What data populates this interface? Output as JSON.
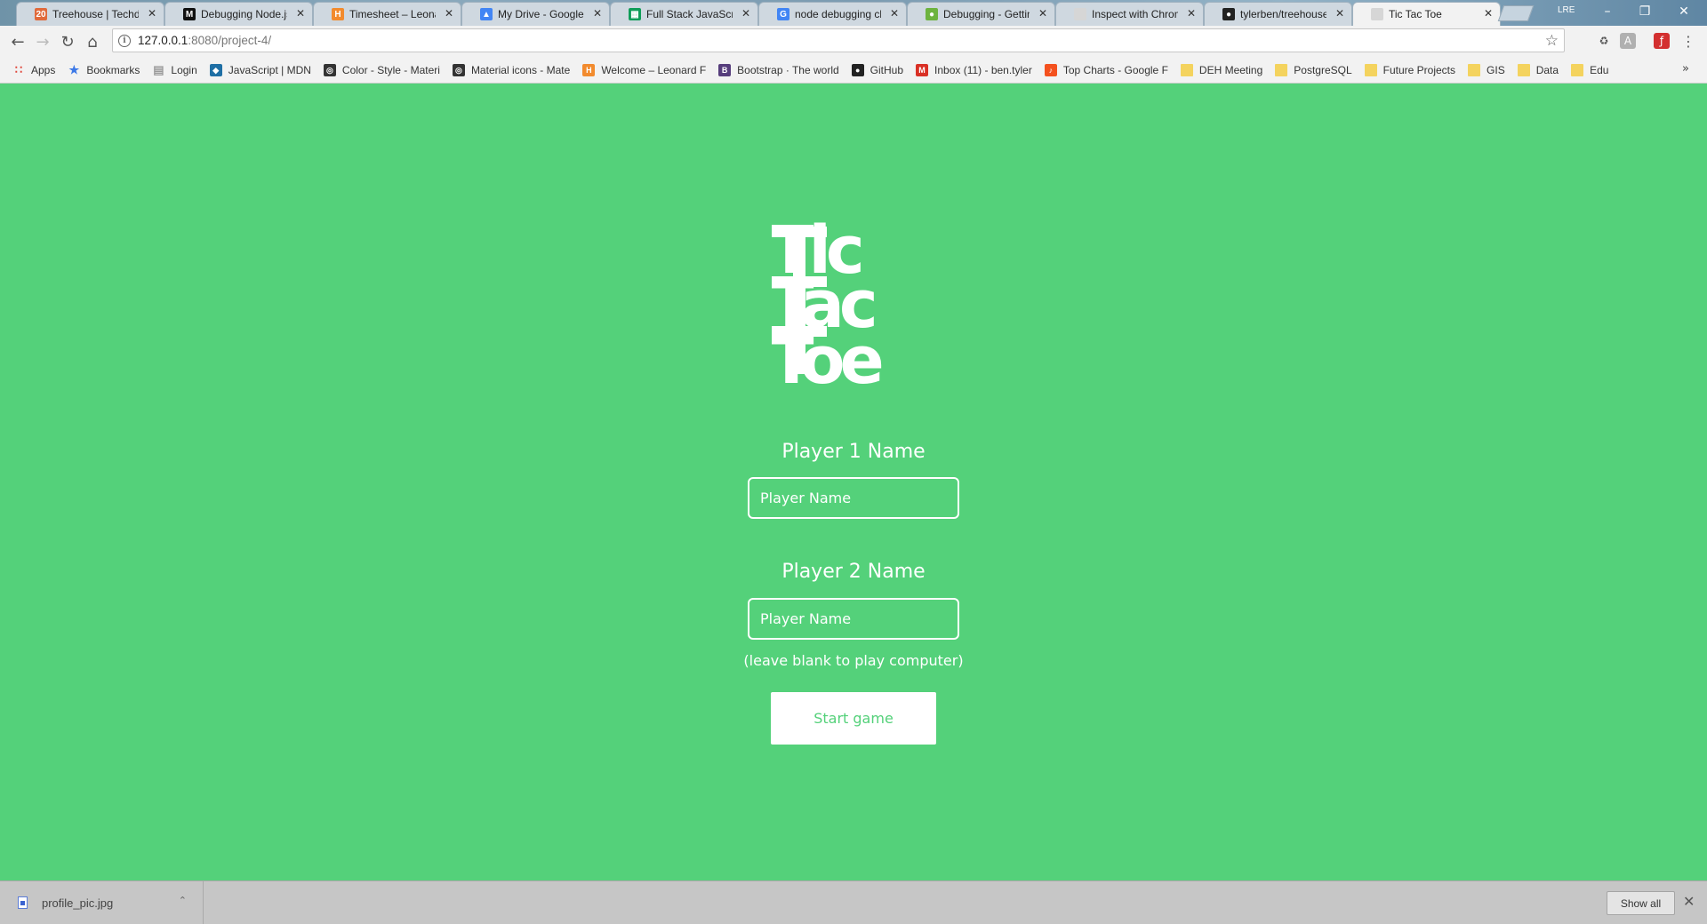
{
  "browser": {
    "tabs": [
      {
        "title": "Treehouse | Techdeg",
        "favicon_text": "20",
        "favicon_color": "#e06a3b"
      },
      {
        "title": "Debugging Node.js",
        "favicon_text": "M",
        "favicon_color": "#111111"
      },
      {
        "title": "Timesheet – Leonar",
        "favicon_text": "H",
        "favicon_color": "#f28b2e"
      },
      {
        "title": "My Drive - Google D",
        "favicon_text": "▲",
        "favicon_color": "#4285f4"
      },
      {
        "title": "Full Stack JavaScript",
        "favicon_text": "▦",
        "favicon_color": "#0f9d58"
      },
      {
        "title": "node debugging ch",
        "favicon_text": "G",
        "favicon_color": "#4285f4"
      },
      {
        "title": "Debugging - Gettin",
        "favicon_text": "●",
        "favicon_color": "#6db33f"
      },
      {
        "title": "Inspect with Chrom",
        "favicon_text": "",
        "favicon_color": "#d6d6d6"
      },
      {
        "title": "tylerben/treehouse",
        "favicon_text": "●",
        "favicon_color": "#222222"
      },
      {
        "title": "Tic Tac Toe",
        "favicon_text": "",
        "favicon_color": "#d6d6d6"
      }
    ],
    "profile_label": "LRE",
    "address": {
      "host": "127.0.0.1",
      "path": ":8080/project-4/"
    },
    "bookmarks": [
      {
        "label": "Apps",
        "icon": "apps-grid-icon",
        "color": "#e0463a"
      },
      {
        "label": "Bookmarks",
        "icon": "star-icon",
        "color": "#3b78e7"
      },
      {
        "label": "Login",
        "icon": "page-icon",
        "color": "#9a9a9a"
      },
      {
        "label": "JavaScript | MDN",
        "icon": "mdn-icon",
        "color": "#1f6fa5"
      },
      {
        "label": "Color - Style - Materi",
        "icon": "material-icon",
        "color": "#333333"
      },
      {
        "label": "Material icons - Mate",
        "icon": "material-icon",
        "color": "#333333"
      },
      {
        "label": "Welcome – Leonard F",
        "icon": "harvest-icon",
        "color": "#f28b2e"
      },
      {
        "label": "Bootstrap · The world",
        "icon": "bootstrap-icon",
        "color": "#563d7c"
      },
      {
        "label": "GitHub",
        "icon": "github-icon",
        "color": "#222222"
      },
      {
        "label": "Inbox (11) - ben.tyler",
        "icon": "gmail-icon",
        "color": "#d93025"
      },
      {
        "label": "Top Charts - Google F",
        "icon": "charts-icon",
        "color": "#f4511e"
      },
      {
        "label": "DEH Meeting",
        "icon": "folder-icon",
        "color": "#f4d35e"
      },
      {
        "label": "PostgreSQL",
        "icon": "folder-icon",
        "color": "#f4d35e"
      },
      {
        "label": "Future Projects",
        "icon": "folder-icon",
        "color": "#f4d35e"
      },
      {
        "label": "GIS",
        "icon": "folder-icon",
        "color": "#f4d35e"
      },
      {
        "label": "Data",
        "icon": "folder-icon",
        "color": "#f4d35e"
      },
      {
        "label": "Edu",
        "icon": "folder-icon",
        "color": "#f4d35e"
      }
    ]
  },
  "page": {
    "background": "#54d17a",
    "logo": [
      "Tic",
      "Tac",
      "Toe"
    ],
    "player1_label": "Player 1 Name",
    "player1_placeholder": "Player Name",
    "player2_label": "Player 2 Name",
    "player2_placeholder": "Player Name",
    "hint": "(leave blank to play computer)",
    "start_button": "Start game"
  },
  "downloads": {
    "file_name": "profile_pic.jpg",
    "show_all": "Show all"
  }
}
